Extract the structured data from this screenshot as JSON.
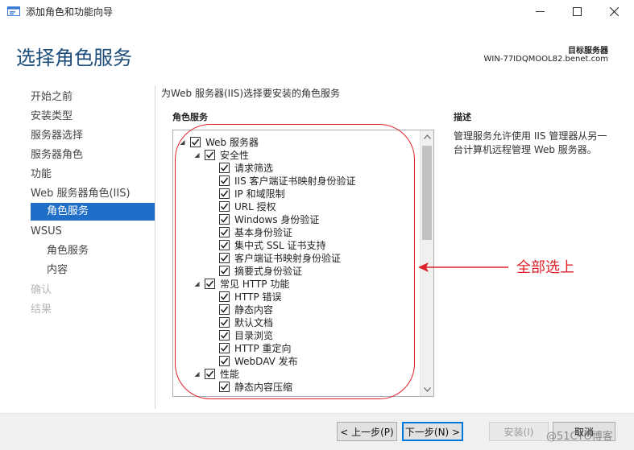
{
  "window": {
    "title": "添加角色和功能向导",
    "controls": {
      "minimize": "—",
      "maximize": "☐",
      "close": "✕"
    }
  },
  "header": {
    "page_title": "选择角色服务",
    "dest_label": "目标服务器",
    "dest_server": "WIN-77IDQMOOL82.benet.com"
  },
  "nav": {
    "items": [
      {
        "label": "开始之前",
        "state": "normal"
      },
      {
        "label": "安装类型",
        "state": "normal"
      },
      {
        "label": "服务器选择",
        "state": "normal"
      },
      {
        "label": "服务器角色",
        "state": "normal"
      },
      {
        "label": "功能",
        "state": "normal"
      },
      {
        "label": "Web 服务器角色(IIS)",
        "state": "normal"
      },
      {
        "label": "角色服务",
        "state": "active"
      },
      {
        "label": "WSUS",
        "state": "normal"
      },
      {
        "label": "角色服务",
        "state": "sub"
      },
      {
        "label": "内容",
        "state": "sub"
      },
      {
        "label": "确认",
        "state": "disabled"
      },
      {
        "label": "结果",
        "state": "disabled"
      }
    ]
  },
  "main": {
    "intro": "为Web 服务器(IIS)选择要安装的角色服务",
    "role_services_header": "角色服务",
    "description_header": "描述",
    "description_text": "管理服务允许使用 IIS 管理器从另一台计算机远程管理 Web 服务器。"
  },
  "tree": {
    "items": [
      {
        "label": "Web 服务器",
        "level": 0,
        "expander": true,
        "checked": true
      },
      {
        "label": "安全性",
        "level": 1,
        "expander": true,
        "checked": true
      },
      {
        "label": "请求筛选",
        "level": 2,
        "expander": false,
        "checked": true
      },
      {
        "label": "IIS 客户端证书映射身份验证",
        "level": 2,
        "expander": false,
        "checked": true
      },
      {
        "label": "IP 和域限制",
        "level": 2,
        "expander": false,
        "checked": true
      },
      {
        "label": "URL 授权",
        "level": 2,
        "expander": false,
        "checked": true
      },
      {
        "label": "Windows 身份验证",
        "level": 2,
        "expander": false,
        "checked": true
      },
      {
        "label": "基本身份验证",
        "level": 2,
        "expander": false,
        "checked": true
      },
      {
        "label": "集中式 SSL 证书支持",
        "level": 2,
        "expander": false,
        "checked": true
      },
      {
        "label": "客户端证书映射身份验证",
        "level": 2,
        "expander": false,
        "checked": true
      },
      {
        "label": "摘要式身份验证",
        "level": 2,
        "expander": false,
        "checked": true
      },
      {
        "label": "常见 HTTP 功能",
        "level": 1,
        "expander": true,
        "checked": true
      },
      {
        "label": "HTTP 错误",
        "level": 2,
        "expander": false,
        "checked": true
      },
      {
        "label": "静态内容",
        "level": 2,
        "expander": false,
        "checked": true
      },
      {
        "label": "默认文档",
        "level": 2,
        "expander": false,
        "checked": true
      },
      {
        "label": "目录浏览",
        "level": 2,
        "expander": false,
        "checked": true
      },
      {
        "label": "HTTP 重定向",
        "level": 2,
        "expander": false,
        "checked": true
      },
      {
        "label": "WebDAV 发布",
        "level": 2,
        "expander": false,
        "checked": true
      },
      {
        "label": "性能",
        "level": 1,
        "expander": true,
        "checked": true
      },
      {
        "label": "静态内容压缩",
        "level": 2,
        "expander": false,
        "checked": true
      }
    ]
  },
  "annotation": {
    "text": "全部选上",
    "color": "#e0202a"
  },
  "footer": {
    "prev_label": "< 上一步(P)",
    "next_label": "下一步(N) >",
    "install_label": "安装(I)",
    "cancel_label": "取消"
  },
  "watermark": "@51CTO博客",
  "colors": {
    "accent": "#1f6ec7",
    "title": "#1e4e79",
    "annotation": "#e0202a"
  },
  "icons": {
    "app": "wizard-icon",
    "expander": "triangle-expander-icon",
    "checkmark": "checkmark-icon"
  }
}
